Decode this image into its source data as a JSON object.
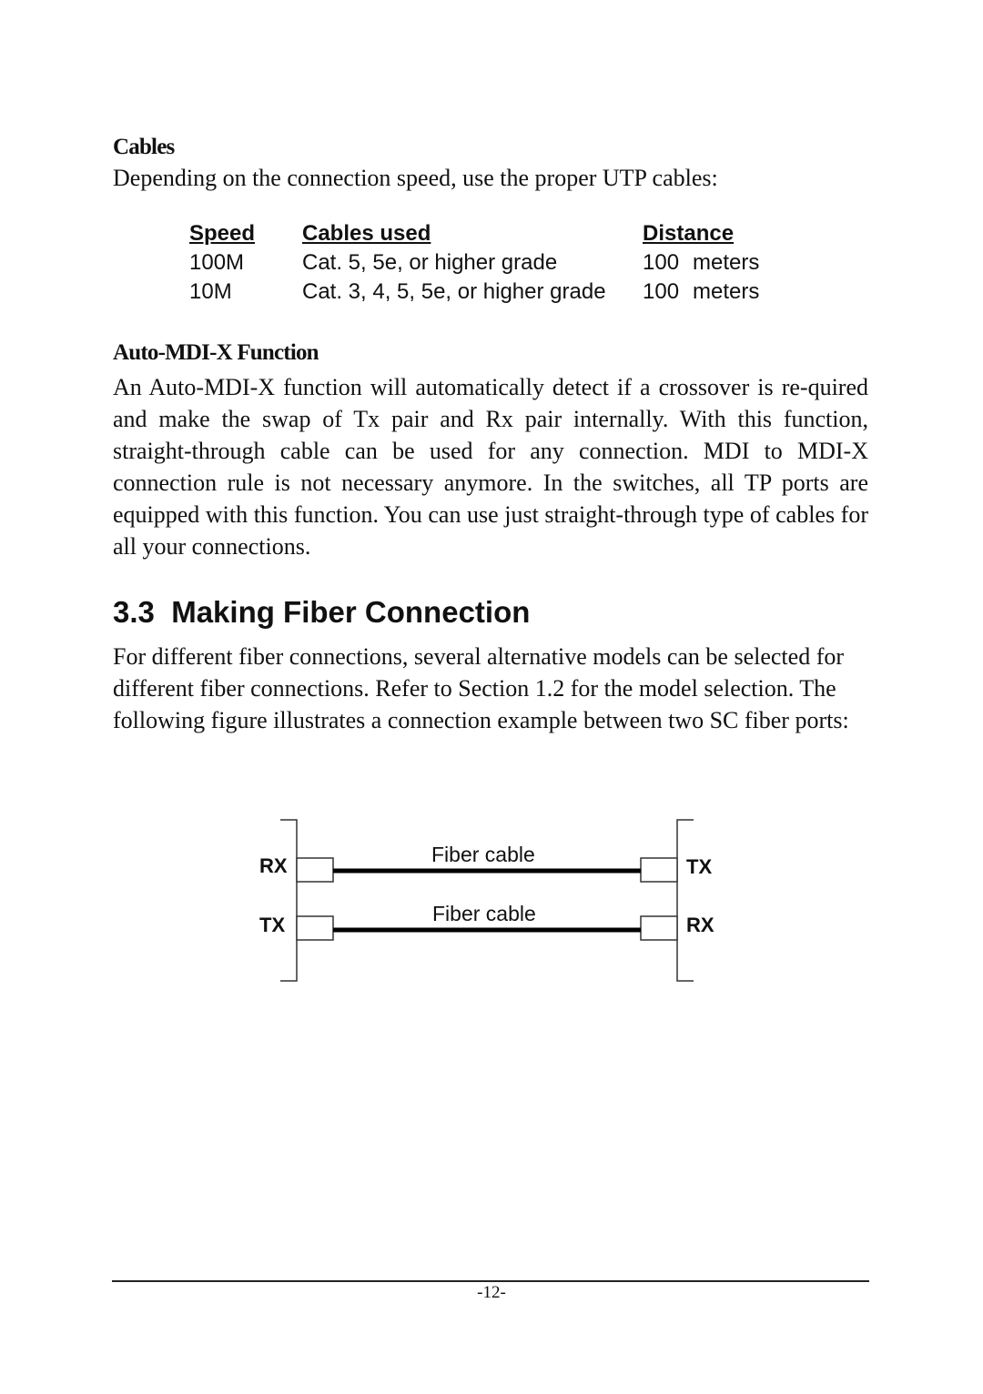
{
  "cables_section": {
    "heading": "Cables",
    "intro": "Depending on the connection speed, use the proper UTP cables:",
    "table": {
      "headers": [
        "Speed",
        "Cables used",
        "Distance"
      ],
      "rows": [
        {
          "speed": "100M",
          "cables": "Cat. 5, 5e, or higher grade",
          "distance_value": "100",
          "distance_unit": "meters"
        },
        {
          "speed": "10M",
          "cables": "Cat. 3, 4, 5, 5e, or higher grade",
          "distance_value": "100",
          "distance_unit": "meters"
        }
      ]
    }
  },
  "auto_mdix_section": {
    "heading": "Auto-MDI-X Function",
    "body": "An Auto-MDI-X function will automatically detect if a crossover is re-quired and make the swap of Tx pair and Rx pair internally. With this function, straight-through cable can be used for any connection. MDI to MDI-X connection rule is not necessary anymore. In the switches, all TP ports are equipped with this function. You can use just straight-through type of cables for all your connections."
  },
  "fiber_section": {
    "title": "3.3  Making Fiber Connection",
    "body": "For different fiber connections, several alternative models can be selected for different fiber connections. Refer to Section 1.2 for the model selection. The following figure illustrates a connection example between two SC fiber ports:"
  },
  "diagram": {
    "left_ports": [
      "RX",
      "TX"
    ],
    "right_ports": [
      "TX",
      "RX"
    ],
    "cable_labels": [
      "Fiber cable",
      "Fiber cable"
    ]
  },
  "footer": {
    "page_number": "-12-"
  }
}
